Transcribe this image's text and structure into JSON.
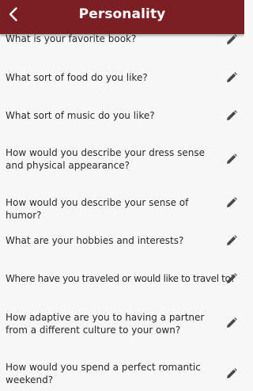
{
  "header": {
    "title": "Personality",
    "background": "#7b1f24"
  },
  "questions": [
    {
      "text": "What is your favorite book?"
    },
    {
      "text": "What sort of food do you like?"
    },
    {
      "text": "What sort of music do you like?"
    },
    {
      "text": "How would you describe your dress sense and physical appearance?"
    },
    {
      "text": "How would you describe your sense of humor?"
    },
    {
      "text": "What are your hobbies and interests?"
    },
    {
      "text": "Where have you traveled or would like to travel to?"
    },
    {
      "text": "How adaptive are you to having a partner from a different culture to your own?"
    },
    {
      "text": "How would you spend a perfect romantic weekend?"
    }
  ],
  "icons": {
    "back": "chevron-left-icon",
    "edit": "pencil-icon"
  }
}
